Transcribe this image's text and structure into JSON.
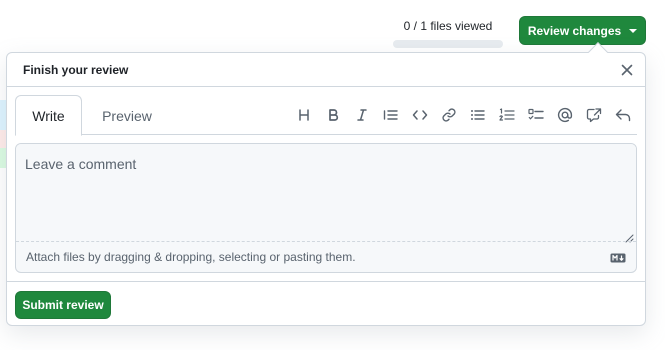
{
  "header": {
    "files_viewed_text": "0 / 1 files viewed",
    "files_viewed_progress": 0,
    "review_button_label": "Review changes"
  },
  "popover": {
    "title": "Finish your review",
    "tabs": [
      {
        "label": "Write",
        "selected": true
      },
      {
        "label": "Preview",
        "selected": false
      }
    ],
    "toolbar_icons": [
      "heading-icon",
      "bold-icon",
      "italic-icon",
      "quote-icon",
      "code-icon",
      "link-icon",
      "unordered-list-icon",
      "ordered-list-icon",
      "task-list-icon",
      "mention-icon",
      "cross-reference-icon",
      "reply-icon"
    ],
    "comment_placeholder": "Leave a comment",
    "attach_text": "Attach files by dragging & dropping, selecting or pasting them.",
    "submit_label": "Submit review"
  },
  "colors": {
    "accent_green": "#1f883d",
    "border": "#d0d7de",
    "muted_text": "#59636e"
  }
}
